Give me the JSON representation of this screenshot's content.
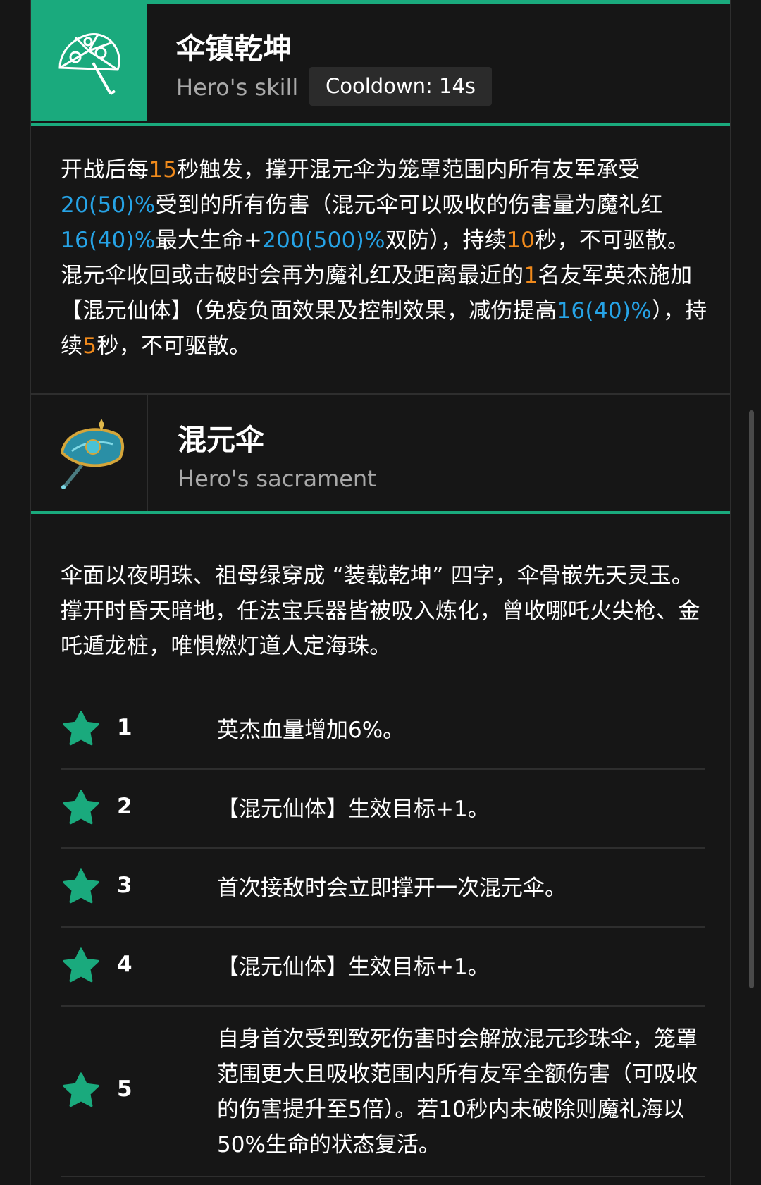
{
  "skill": {
    "title": "伞镇乾坤",
    "type_label": "Hero's skill",
    "cooldown": "Cooldown: 14s",
    "icon": "umbrella-icon",
    "description": [
      {
        "t": "开战后每",
        "c": "w"
      },
      {
        "t": "15",
        "c": "o"
      },
      {
        "t": "秒触发，撑开混元伞为笼罩范围内所有友军承受",
        "c": "w"
      },
      {
        "t": "20(50)%",
        "c": "b"
      },
      {
        "t": "受到的所有伤害（混元伞可以吸收的伤害量为魔礼红",
        "c": "w"
      },
      {
        "t": "16(40)%",
        "c": "b"
      },
      {
        "t": "最大生命+",
        "c": "w"
      },
      {
        "t": "200(500)%",
        "c": "b"
      },
      {
        "t": "双防），持续",
        "c": "w"
      },
      {
        "t": "10",
        "c": "o"
      },
      {
        "t": "秒，不可驱散。混元伞收回或击破时会再为魔礼红及距离最近的",
        "c": "w"
      },
      {
        "t": "1",
        "c": "o"
      },
      {
        "t": "名友军英杰施加【混元仙体】（免疫负面效果及控制效果，减伤提高",
        "c": "w"
      },
      {
        "t": "16(40)%",
        "c": "b"
      },
      {
        "t": "），持续",
        "c": "w"
      },
      {
        "t": "5",
        "c": "o"
      },
      {
        "t": "秒，不可驱散。",
        "c": "w"
      }
    ]
  },
  "sacrament": {
    "title": "混元伞",
    "type_label": "Hero's sacrament",
    "icon": "jeweled-umbrella-icon",
    "description": "伞面以夜明珠、祖母绿穿成 “装载乾坤” 四字，伞骨嵌先天灵玉。撑开时昏天暗地，任法宝兵器皆被吸入炼化，曾收哪吒火尖枪、金吒遁龙桩，唯惧燃灯道人定海珠。"
  },
  "stars": [
    {
      "level": "1",
      "text": "英杰血量增加6%。"
    },
    {
      "level": "2",
      "text": "【混元仙体】生效目标+1。"
    },
    {
      "level": "3",
      "text": "首次接敌时会立即撑开一次混元伞。"
    },
    {
      "level": "4",
      "text": "【混元仙体】生效目标+1。"
    },
    {
      "level": "5",
      "text": "自身首次受到致死伤害时会解放混元珍珠伞，笼罩范围更大且吸收范围内所有友军全额伤害（可吸收的伤害提升至5倍）。若10秒内未破除则魔礼海以50%生命的状态复活。"
    }
  ],
  "colors": {
    "accent": "#1aaa7d",
    "highlight_orange": "#f08a1c",
    "highlight_blue": "#26a3e6",
    "background": "#161616"
  }
}
